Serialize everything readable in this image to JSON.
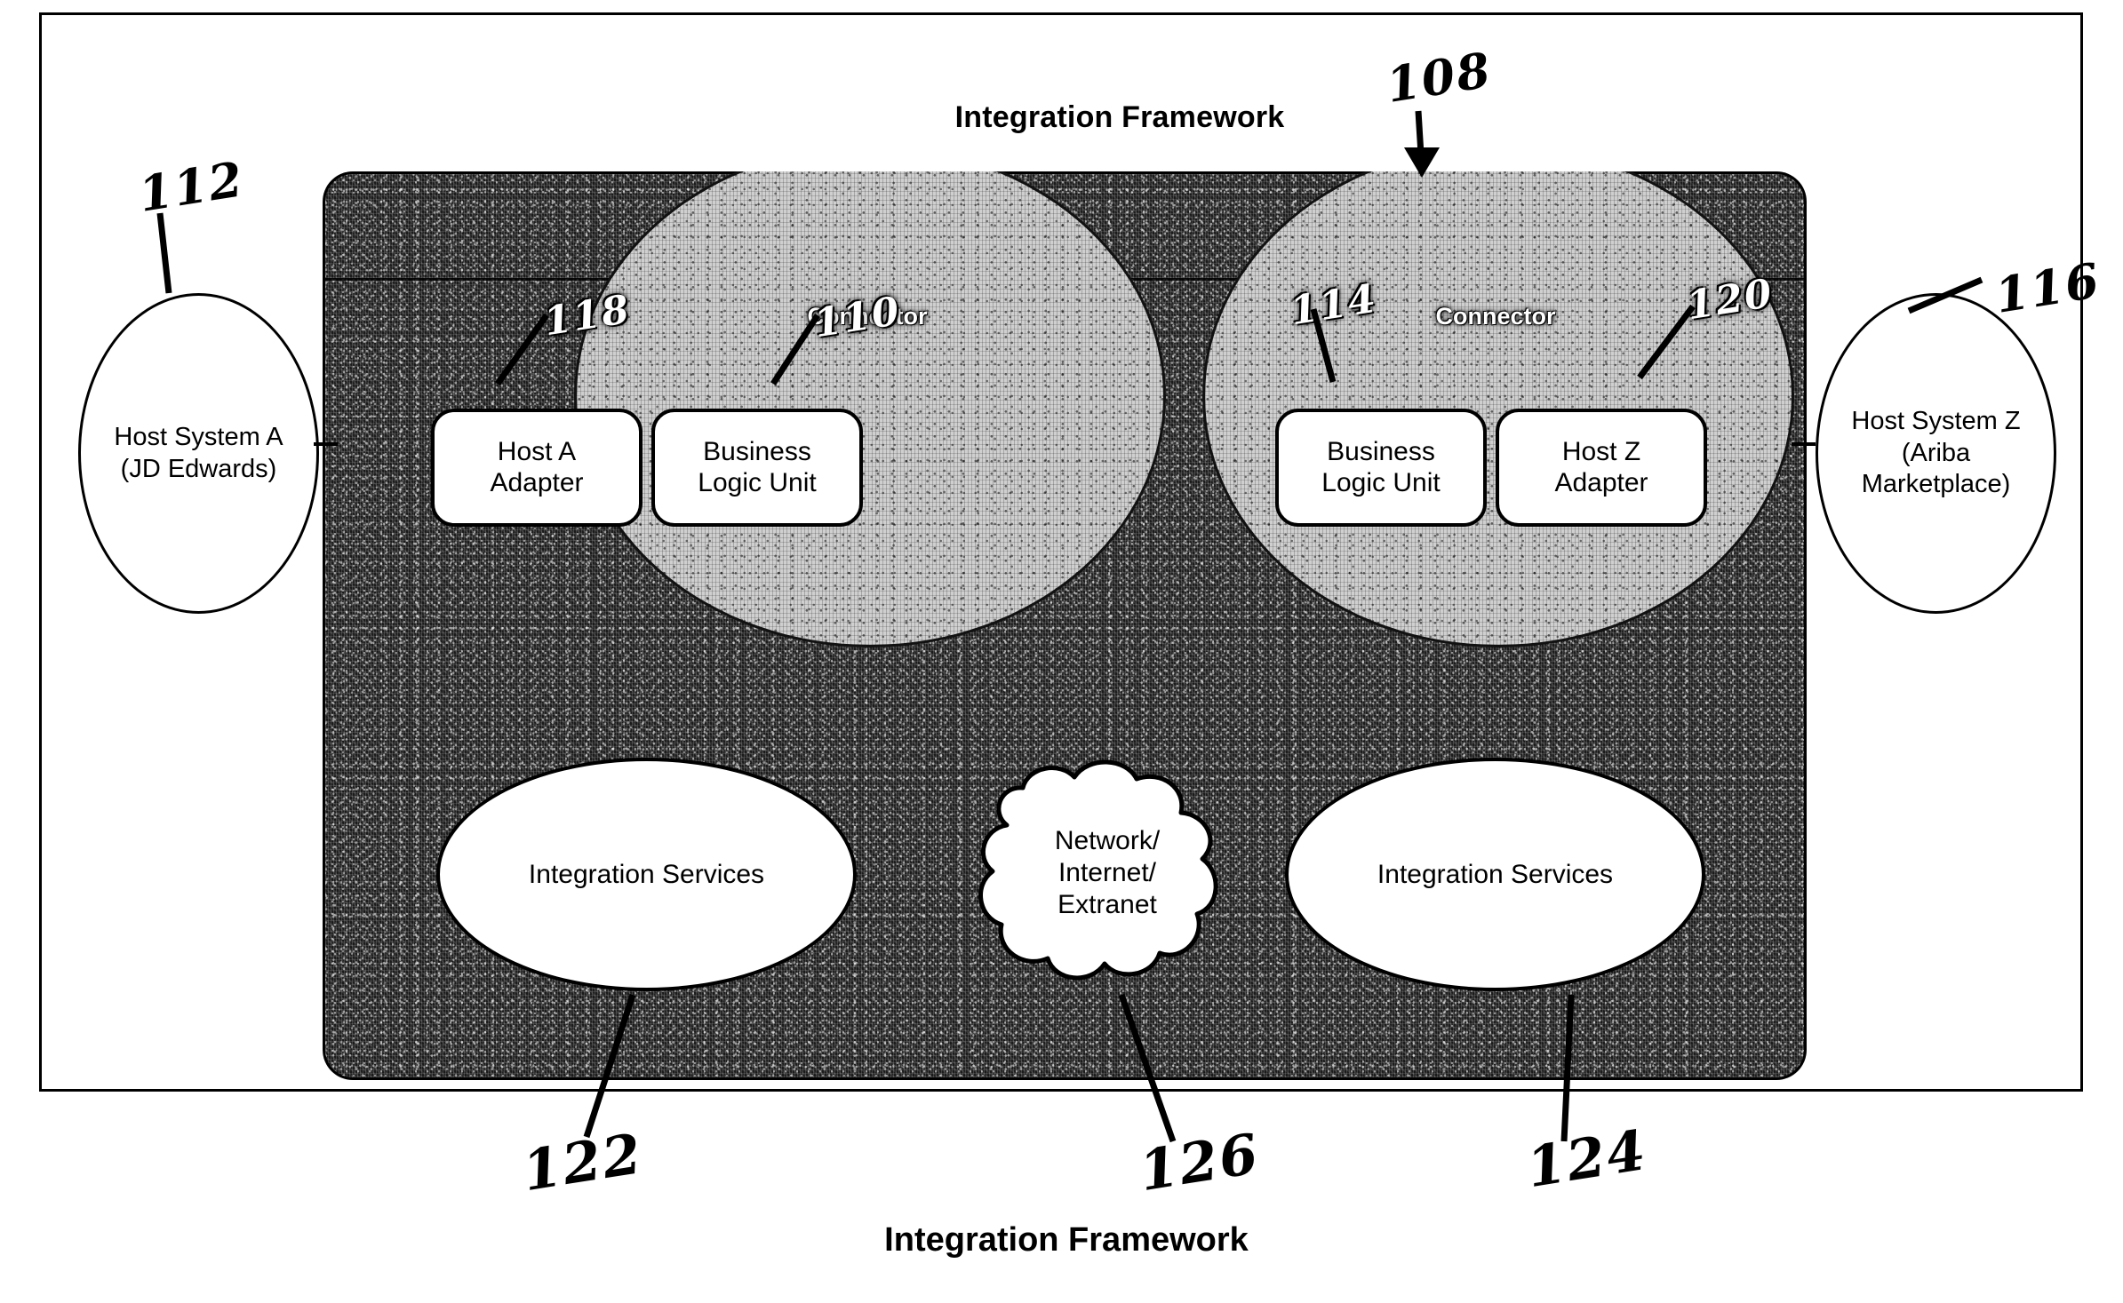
{
  "figure": {
    "title_top": "Integration Framework",
    "title_bottom": "Integration Framework"
  },
  "hosts": {
    "left": {
      "line1": "Host System A",
      "line2": "(JD Edwards)"
    },
    "right": {
      "line1": "Host System Z",
      "line2": "(Ariba",
      "line3": "Marketplace)"
    }
  },
  "connectors": {
    "left_label": "Connector",
    "right_label": "Connector"
  },
  "units": {
    "host_a_adapter": {
      "line1": "Host A",
      "line2": "Adapter"
    },
    "business_logic_left": {
      "line1": "Business",
      "line2": "Logic Unit"
    },
    "business_logic_right": {
      "line1": "Business",
      "line2": "Logic Unit"
    },
    "host_z_adapter": {
      "line1": "Host Z",
      "line2": "Adapter"
    }
  },
  "services": {
    "left_label": "Integration Services",
    "right_label": "Integration Services"
  },
  "cloud": {
    "line1": "Network/",
    "line2": "Internet/",
    "line3": "Extranet"
  },
  "reference_numerals": {
    "framework": "108",
    "business_logic_left": "110",
    "host_system_a": "112",
    "business_logic_right": "114",
    "host_system_z": "116",
    "host_a_adapter": "118",
    "host_z_adapter": "120",
    "integration_services_left": "122",
    "integration_services_right": "124",
    "network_cloud": "126"
  },
  "colors": {
    "ink": "#000000",
    "paper": "#ffffff",
    "framework_fill": "#1b1b1b",
    "connector_fill": "#cfcfcf"
  }
}
